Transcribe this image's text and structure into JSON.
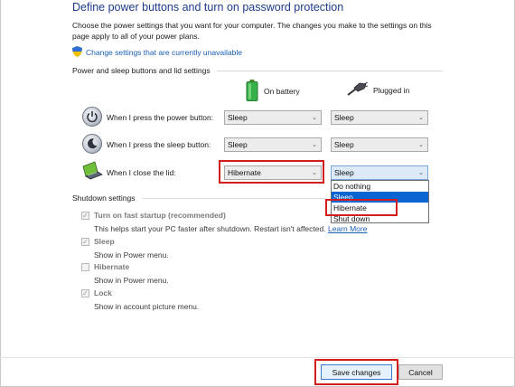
{
  "header": {
    "title": "Define power buttons and turn on password protection",
    "intro": "Choose the power settings that you want for your computer. The changes you make to the settings on this page apply to all of your power plans.",
    "change_link": "Change settings that are currently unavailable",
    "shield_icon": "uac-shield-icon"
  },
  "power_section": {
    "title": "Power and sleep buttons and lid settings",
    "col_battery": "On battery",
    "col_plugged": "Plugged in",
    "rows": [
      {
        "label": "When I press the power button:",
        "battery": "Sleep",
        "plugged": "Sleep",
        "icon": "power-button-icon"
      },
      {
        "label": "When I press the sleep button:",
        "battery": "Sleep",
        "plugged": "Sleep",
        "icon": "sleep-button-icon"
      },
      {
        "label": "When I close the lid:",
        "battery": "Hibernate",
        "plugged": "Sleep",
        "icon": "laptop-lid-icon"
      }
    ]
  },
  "dropdown": {
    "options": [
      "Do nothing",
      "Sleep",
      "Hibernate",
      "Shut down"
    ],
    "highlighted": "Sleep"
  },
  "shutdown_section": {
    "title": "Shutdown settings",
    "items": [
      {
        "title": "Turn on fast startup (recommended)",
        "desc": "This helps start your PC faster after shutdown. Restart isn't affected.",
        "link": "Learn More",
        "checked": true
      },
      {
        "title": "Sleep",
        "desc": "Show in Power menu.",
        "checked": true
      },
      {
        "title": "Hibernate",
        "desc": "Show in Power menu.",
        "checked": false
      },
      {
        "title": "Lock",
        "desc": "Show in account picture menu.",
        "checked": true
      }
    ]
  },
  "footer": {
    "save_label": "Save changes",
    "cancel_label": "Cancel"
  },
  "colors": {
    "title_blue": "#1e3c8c",
    "link_blue": "#1a5fb4",
    "highlight_red": "#d41c1c",
    "selected_blue": "#0a64d2"
  }
}
